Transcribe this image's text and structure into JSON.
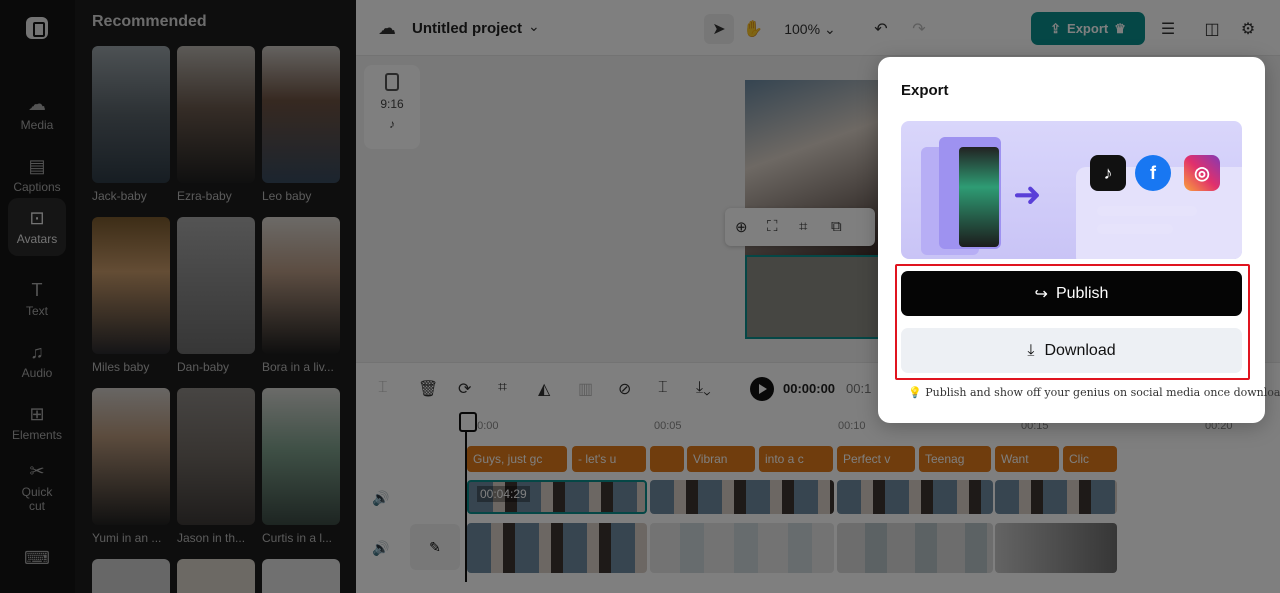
{
  "sidebar": {
    "items": [
      {
        "label": "Media",
        "icon": "cloud-upload-icon"
      },
      {
        "label": "Captions",
        "icon": "captions-icon"
      },
      {
        "label": "Avatars",
        "icon": "avatar-icon"
      },
      {
        "label": "Text",
        "icon": "text-icon"
      },
      {
        "label": "Audio",
        "icon": "music-note-icon"
      },
      {
        "label": "Elements",
        "icon": "elements-icon"
      },
      {
        "label": "Quick cut",
        "icon": "quick-cut-icon"
      }
    ]
  },
  "panel": {
    "title": "Recommended",
    "avatars": [
      {
        "label": "Jack-baby"
      },
      {
        "label": "Ezra-baby"
      },
      {
        "label": "Leo baby"
      },
      {
        "label": "Miles baby"
      },
      {
        "label": "Dan-baby"
      },
      {
        "label": "Bora in a liv..."
      },
      {
        "label": "Yumi in an ..."
      },
      {
        "label": "Jason in th..."
      },
      {
        "label": "Curtis in a l..."
      }
    ]
  },
  "topbar": {
    "project_name": "Untitled project",
    "zoom": "100%",
    "export_label": "Export"
  },
  "canvas": {
    "ratio": "9:16"
  },
  "timeline": {
    "current_time": "00:00:00",
    "total_time_partial": "00:1",
    "ruler": [
      "00:00",
      "00:05",
      "00:10",
      "00:15",
      "00:20"
    ],
    "captions": [
      "Guys, just gc",
      "- let's u",
      "",
      "Vibran",
      "into a c",
      "Perfect v",
      "Teenag",
      "Want",
      "Clic"
    ],
    "clip_duration": "00:04:29"
  },
  "export_modal": {
    "title": "Export",
    "publish_label": "Publish",
    "download_label": "Download",
    "hint": "Publish and show off your genius on social media once downloaded."
  }
}
